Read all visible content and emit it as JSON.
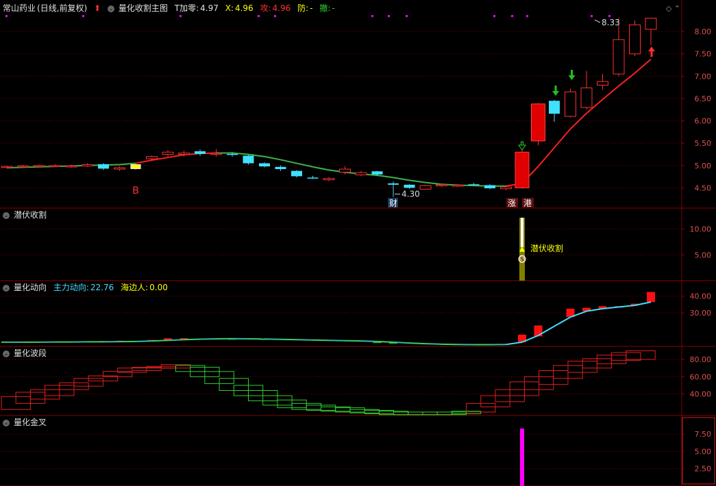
{
  "header": {
    "stock_name": "常山药业",
    "period": "(日线,前复权)",
    "indicator_name": "量化收割主图",
    "t_label": "T加零:",
    "t_value": "4.97",
    "x_label": "X:",
    "x_value": "4.96",
    "gong_label": "攻:",
    "gong_value": "4.96",
    "fang_label": "防:",
    "fang_value": "-",
    "che_label": "撤:",
    "che_value": "-"
  },
  "panels": {
    "p2_title": "潜伏收割",
    "p3_title": "量化动向",
    "p3_main_label": "主力动向:",
    "p3_main_value": "22.76",
    "p3_hai_label": "海边人:",
    "p3_hai_value": "0.00",
    "p4_title": "量化波段",
    "p5_title": "量化金叉"
  },
  "colors": {
    "background": "#000000",
    "grid": "#8b0000",
    "up": "#ff3030",
    "down": "#40e0ff",
    "ma_down": "#3cb44b",
    "ma_up": "#ff2020",
    "magenta": "#ff00ff",
    "yellow": "#ffff00"
  },
  "chart_data": [
    {
      "type": "candlestick",
      "title": "量化收割主图",
      "ylim": [
        4.2,
        8.4
      ],
      "yticks": [
        "4.50",
        "5.00",
        "5.50",
        "6.00",
        "6.50",
        "7.00",
        "7.50",
        "8.00"
      ],
      "ohlc": [
        [
          4.96,
          5.0,
          4.93,
          4.98
        ],
        [
          4.97,
          5.01,
          4.95,
          4.99
        ],
        [
          4.98,
          5.02,
          4.96,
          5.0
        ],
        [
          5.0,
          5.03,
          4.97,
          5.0
        ],
        [
          4.98,
          5.02,
          4.95,
          4.99
        ],
        [
          4.99,
          5.05,
          4.97,
          5.02
        ],
        [
          5.03,
          5.05,
          4.9,
          4.93
        ],
        [
          4.92,
          4.98,
          4.88,
          4.95
        ],
        [
          4.93,
          5.05,
          4.9,
          5.02
        ],
        [
          5.15,
          5.22,
          5.1,
          5.2
        ],
        [
          5.25,
          5.35,
          5.2,
          5.3
        ],
        [
          5.25,
          5.33,
          5.2,
          5.28
        ],
        [
          5.32,
          5.36,
          5.22,
          5.26
        ],
        [
          5.27,
          5.37,
          5.2,
          5.27
        ],
        [
          5.26,
          5.3,
          5.2,
          5.25
        ],
        [
          5.22,
          5.24,
          5.02,
          5.05
        ],
        [
          5.05,
          5.07,
          4.96,
          4.98
        ],
        [
          4.97,
          5.0,
          4.88,
          4.92
        ],
        [
          4.88,
          4.9,
          4.73,
          4.76
        ],
        [
          4.73,
          4.77,
          4.7,
          4.72
        ],
        [
          4.68,
          4.74,
          4.65,
          4.71
        ],
        [
          4.85,
          4.98,
          4.8,
          4.92
        ],
        [
          4.79,
          4.88,
          4.76,
          4.84
        ],
        [
          4.87,
          4.88,
          4.77,
          4.8
        ],
        [
          4.6,
          4.64,
          4.3,
          4.57
        ],
        [
          4.57,
          4.58,
          4.48,
          4.5
        ],
        [
          4.47,
          4.57,
          4.46,
          4.55
        ],
        [
          4.55,
          4.59,
          4.52,
          4.57
        ],
        [
          4.55,
          4.58,
          4.52,
          4.56
        ],
        [
          4.58,
          4.61,
          4.55,
          4.56
        ],
        [
          4.56,
          4.58,
          4.47,
          4.49
        ],
        [
          4.48,
          4.56,
          4.45,
          4.52
        ],
        [
          4.5,
          5.34,
          4.48,
          5.3
        ],
        [
          5.55,
          6.4,
          5.45,
          6.38
        ],
        [
          6.45,
          6.47,
          5.98,
          6.16
        ],
        [
          6.1,
          6.72,
          6.08,
          6.65
        ],
        [
          6.3,
          7.12,
          6.25,
          6.74
        ],
        [
          6.8,
          7.05,
          6.7,
          6.88
        ],
        [
          7.05,
          8.3,
          7.0,
          7.82
        ],
        [
          7.5,
          8.25,
          7.45,
          8.15
        ],
        [
          8.05,
          8.3,
          7.7,
          8.3
        ]
      ],
      "ma": [
        4.95,
        4.96,
        4.97,
        4.98,
        4.99,
        5.0,
        5.01,
        5.02,
        5.05,
        5.12,
        5.18,
        5.24,
        5.27,
        5.28,
        5.28,
        5.25,
        5.2,
        5.13,
        5.05,
        4.97,
        4.9,
        4.85,
        4.81,
        4.78,
        4.73,
        4.67,
        4.62,
        4.58,
        4.56,
        4.55,
        4.54,
        4.54,
        4.6,
        4.98,
        5.4,
        5.82,
        6.17,
        6.48,
        6.78,
        7.07,
        7.38
      ],
      "labels": {
        "buy": "B",
        "low": "4.30",
        "high": "8.33",
        "cai": "财",
        "zhang": "涨",
        "gang": "港"
      }
    },
    {
      "type": "bar",
      "title": "潜伏收割",
      "ylim": [
        0,
        13
      ],
      "yticks": [
        "5.00",
        "10.00"
      ],
      "bar_index": 32,
      "bar_value": 12.2,
      "label": "潜伏收割",
      "marker": "S"
    },
    {
      "type": "line",
      "title": "量化动向",
      "ylim": [
        10,
        46
      ],
      "yticks": [
        "30.00",
        "40.00"
      ],
      "series": [
        {
          "name": "主力动向",
          "values": [
            12.5,
            12.5,
            12.5,
            12.6,
            12.6,
            12.7,
            12.7,
            12.8,
            12.9,
            13.2,
            13.6,
            14.0,
            14.3,
            14.5,
            14.6,
            14.5,
            14.4,
            14.2,
            14.0,
            13.8,
            13.6,
            13.4,
            13.2,
            12.9,
            12.5,
            12.0,
            11.6,
            11.3,
            11.1,
            11.0,
            11.0,
            11.1,
            12.5,
            16.5,
            22.0,
            27.5,
            31.0,
            32.5,
            33.5,
            34.5,
            36.5
          ]
        }
      ],
      "red_bars": [
        [
          6,
          13.2,
          12.8
        ],
        [
          7,
          13.4,
          12.9
        ],
        [
          9,
          13.8,
          13.1
        ],
        [
          10,
          14.8,
          13.4
        ],
        [
          11,
          14.9,
          13.9
        ],
        [
          32,
          17.0,
          12.5
        ],
        [
          33,
          22.5,
          16.0
        ],
        [
          35,
          32.5,
          27.5
        ],
        [
          36,
          33.0,
          31.0
        ],
        [
          37,
          34.0,
          32.5
        ],
        [
          38,
          34.0,
          33.5
        ],
        [
          39,
          35.5,
          34.5
        ],
        [
          40,
          42.5,
          36.5
        ]
      ],
      "green_bars": [
        [
          14,
          14.8,
          14.2
        ],
        [
          16,
          14.7,
          14.0
        ],
        [
          23,
          12.8,
          12.3
        ],
        [
          24,
          12.4,
          11.6
        ]
      ]
    },
    {
      "type": "boxes",
      "title": "量化波段",
      "ylim": [
        15,
        92
      ],
      "yticks": [
        "40.00",
        "60.00",
        "80.00"
      ],
      "boxes": [
        [
          22,
          37
        ],
        [
          29,
          42
        ],
        [
          34,
          45
        ],
        [
          38,
          50
        ],
        [
          45,
          53
        ],
        [
          49,
          58
        ],
        [
          55,
          61
        ],
        [
          60,
          66
        ],
        [
          65,
          70
        ],
        [
          67,
          71
        ],
        [
          70,
          72
        ],
        [
          70,
          74
        ],
        [
          66,
          73
        ],
        [
          60,
          71
        ],
        [
          52,
          66
        ],
        [
          44,
          58
        ],
        [
          38,
          50
        ],
        [
          32,
          44
        ],
        [
          27,
          38
        ],
        [
          24,
          33
        ],
        [
          22,
          29
        ],
        [
          21,
          27
        ],
        [
          20,
          25
        ],
        [
          19,
          24
        ],
        [
          18,
          22
        ],
        [
          17,
          21
        ],
        [
          16,
          20
        ],
        [
          16,
          19
        ],
        [
          16,
          19
        ],
        [
          16,
          19
        ],
        [
          16,
          19
        ],
        [
          17,
          20
        ],
        [
          19,
          29
        ],
        [
          25,
          38
        ],
        [
          31,
          45
        ],
        [
          38,
          54
        ],
        [
          45,
          60
        ],
        [
          51,
          67
        ],
        [
          58,
          73
        ],
        [
          65,
          78
        ],
        [
          70,
          81
        ],
        [
          75,
          85
        ],
        [
          79,
          88
        ],
        [
          80,
          90
        ]
      ],
      "green_from": 12,
      "green_to": 31
    },
    {
      "type": "bar",
      "title": "量化金叉",
      "ylim": [
        0,
        9
      ],
      "yticks": [
        "2.50",
        "5.00",
        "7.50"
      ],
      "bar_index": 32,
      "bar_value": 8.3
    }
  ]
}
